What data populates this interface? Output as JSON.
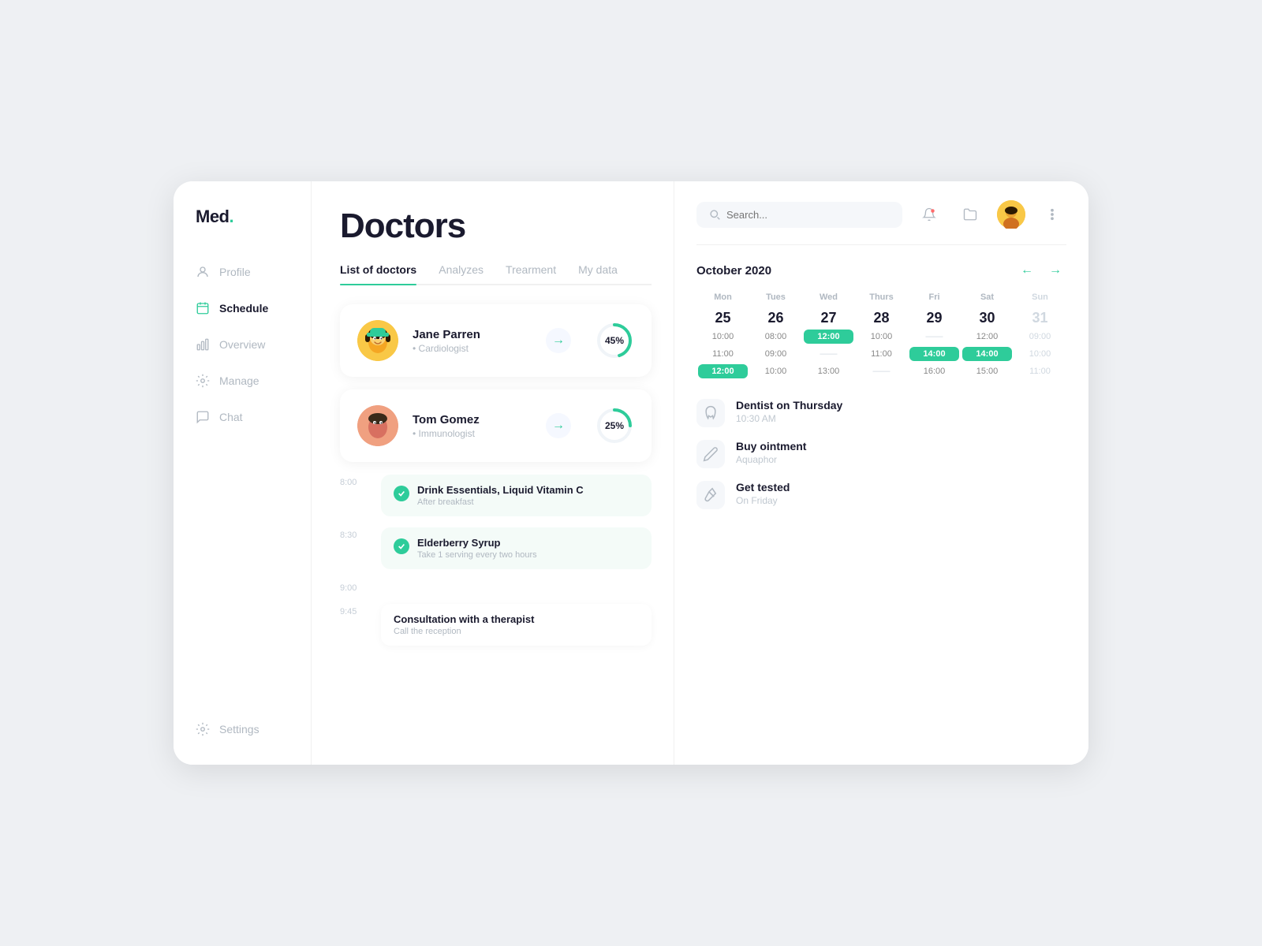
{
  "logo": {
    "text": "Med",
    "dot": "."
  },
  "sidebar": {
    "items": [
      {
        "id": "profile",
        "label": "Profile"
      },
      {
        "id": "schedule",
        "label": "Schedule"
      },
      {
        "id": "overview",
        "label": "Overview"
      },
      {
        "id": "manage",
        "label": "Manage"
      },
      {
        "id": "chat",
        "label": "Chat"
      }
    ],
    "settings": {
      "label": "Settings"
    }
  },
  "page": {
    "title": "Doctors",
    "tabs": [
      {
        "id": "list",
        "label": "List of doctors",
        "active": true
      },
      {
        "id": "analyzes",
        "label": "Analyzes",
        "active": false
      },
      {
        "id": "treatment",
        "label": "Trearment",
        "active": false
      },
      {
        "id": "mydata",
        "label": "My data",
        "active": false
      }
    ]
  },
  "doctors": [
    {
      "name": "Jane Parren",
      "specialty": "Cardiologist",
      "progress": 45,
      "progressLabel": "45%"
    },
    {
      "name": "Tom Gomez",
      "specialty": "Immunologist",
      "progress": 25,
      "progressLabel": "25%"
    }
  ],
  "timeline": [
    {
      "time": "8:00",
      "task": {
        "title": "Drink Essentials, Liquid Vitamin C",
        "subtitle": "After breakfast",
        "checked": true
      }
    },
    {
      "time": "8:30",
      "task": {
        "title": "Elderberry Syrup",
        "subtitle": "Take 1 serving every two hours",
        "checked": true
      }
    },
    {
      "time": "9:00",
      "task": null
    },
    {
      "time": "9:45",
      "task": {
        "title": "Consultation with a therapist",
        "subtitle": "Call the reception",
        "checked": false
      }
    }
  ],
  "header": {
    "search_placeholder": "Search..."
  },
  "calendar": {
    "month": "October 2020",
    "days": [
      {
        "label": "Mon",
        "num": "25",
        "slots": [
          "10:00",
          "11:00",
          "12:00"
        ],
        "slot_highlights": []
      },
      {
        "label": "Tues",
        "num": "26",
        "slots": [
          "08:00",
          "09:00",
          "10:00"
        ],
        "slot_highlights": []
      },
      {
        "label": "Wed",
        "num": "27",
        "slots": [
          "12:00",
          "——",
          "13:00"
        ],
        "slot_highlights": [
          0
        ]
      },
      {
        "label": "Thurs",
        "num": "28",
        "slots": [
          "10:00",
          "11:00",
          "——"
        ],
        "slot_highlights": []
      },
      {
        "label": "Fri",
        "num": "29",
        "slots": [
          "——",
          "14:00",
          "16:00"
        ],
        "slot_highlights": [
          1
        ]
      },
      {
        "label": "Sat",
        "num": "30",
        "slots": [
          "12:00",
          "14:00",
          "15:00"
        ],
        "slot_highlights": [
          1
        ]
      },
      {
        "label": "Sun",
        "num": "31",
        "slots": [
          "09:00",
          "10:00",
          "11:00"
        ],
        "slot_highlights": [],
        "dim": true
      }
    ]
  },
  "reminders": [
    {
      "icon": "tooth",
      "title": "Dentist on Thursday",
      "subtitle": "10:30 AM"
    },
    {
      "icon": "pencil",
      "title": "Buy ointment",
      "subtitle": "Aquaphor"
    },
    {
      "icon": "test-tube",
      "title": "Get tested",
      "subtitle": "On Friday"
    }
  ]
}
